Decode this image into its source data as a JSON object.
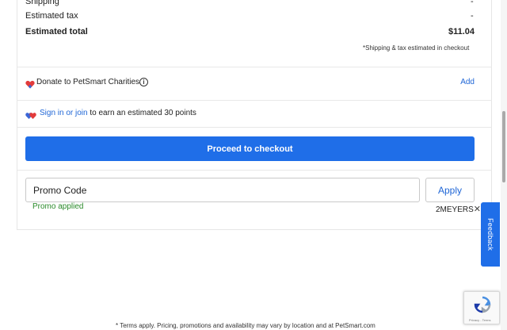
{
  "summary": {
    "shipping_label": "Shipping",
    "shipping_value": "-",
    "tax_label": "Estimated tax",
    "tax_value": "-",
    "total_label": "Estimated total",
    "total_value": "$11.04",
    "footnote": "*Shipping & tax estimated in checkout"
  },
  "donate": {
    "label": "Donate to PetSmart Charities",
    "info_icon": "info-icon",
    "heart_icon": "heart-icon",
    "action": "Add"
  },
  "rewards": {
    "icon": "hearts-icon",
    "link_text": "Sign in or join",
    "text": " to earn an estimated 30 points"
  },
  "checkout": {
    "button_label": "Proceed to checkout"
  },
  "promo": {
    "value": "Promo Code",
    "apply_label": "Apply",
    "status": "Promo applied",
    "code": "2MEYERS",
    "remove_icon": "close-icon"
  },
  "feedback": {
    "label": "Feedback"
  },
  "recaptcha": {
    "text": "Privacy - Terms"
  },
  "footer": {
    "disclaimer": "* Terms apply. Pricing, promotions and availability may vary by location and at PetSmart.com"
  },
  "colors": {
    "accent": "#1f6ee8",
    "link": "#1f66d6",
    "success": "#2a8a2a",
    "heart_red": "#e23b3b",
    "heart_blue": "#3b66d6"
  }
}
